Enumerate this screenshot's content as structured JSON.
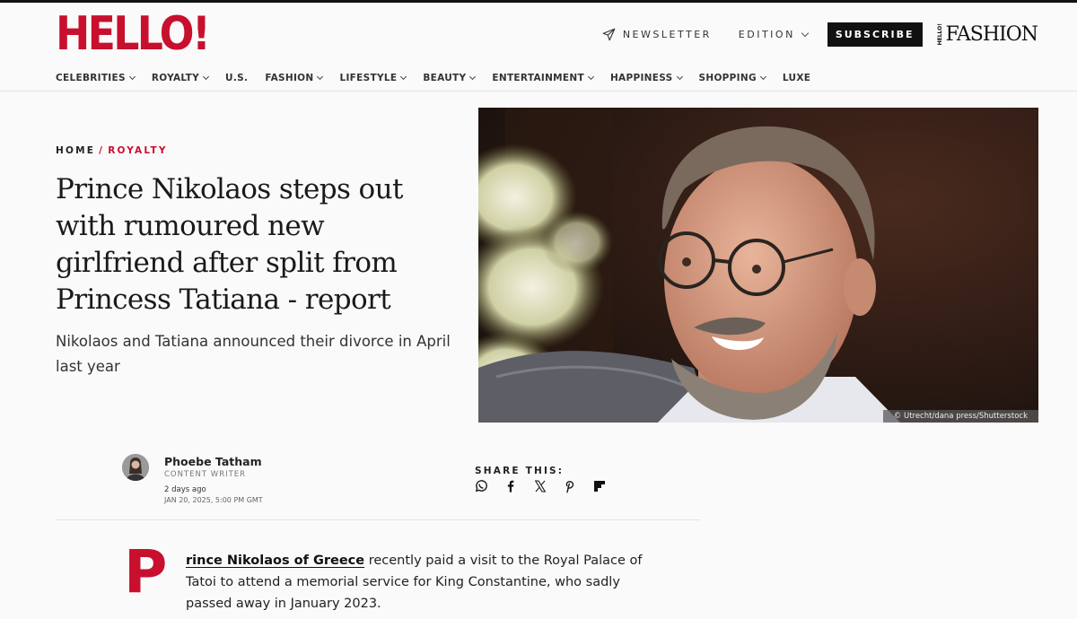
{
  "header": {
    "logo": "HELLO!",
    "newsletter_label": "NEWSLETTER",
    "edition_label": "EDITION",
    "subscribe_label": "SUBSCRIBE",
    "fashion_mini": "HELLO!",
    "fashion_word": "FASHION"
  },
  "nav": {
    "items": [
      {
        "label": "CELEBRITIES",
        "has_dropdown": true
      },
      {
        "label": "ROYALTY",
        "has_dropdown": true
      },
      {
        "label": "U.S.",
        "has_dropdown": false
      },
      {
        "label": "FASHION",
        "has_dropdown": true
      },
      {
        "label": "LIFESTYLE",
        "has_dropdown": true
      },
      {
        "label": "BEAUTY",
        "has_dropdown": true
      },
      {
        "label": "ENTERTAINMENT",
        "has_dropdown": true
      },
      {
        "label": "HAPPINESS",
        "has_dropdown": true
      },
      {
        "label": "SHOPPING",
        "has_dropdown": true
      },
      {
        "label": "LUXE",
        "has_dropdown": false
      }
    ]
  },
  "breadcrumb": {
    "home": "HOME",
    "separator": "/",
    "category": "ROYALTY"
  },
  "article": {
    "headline": "Prince Nikolaos steps out with rumoured new girlfriend after split from Princess Tatiana - report",
    "dek": "Nikolaos and Tatiana announced their divorce in April last year",
    "image_credit": "© Utrecht/dana press/Shutterstock",
    "author": {
      "name": "Phoebe Tatham",
      "role": "CONTENT WRITER",
      "date_relative": "2 days ago",
      "date_absolute": "JAN 20, 2025, 5:00 PM GMT"
    },
    "share_label": "SHARE THIS:",
    "share_icons": [
      "whatsapp-icon",
      "facebook-icon",
      "x-icon",
      "pinterest-icon",
      "flipboard-icon"
    ],
    "dropcap": "P",
    "body_link": "rince Nikolaos of Greece",
    "body_rest": " recently paid a visit to the Royal Palace of Tatoi to attend a memorial service for King Constantine, who sadly passed away in January 2023."
  },
  "colors": {
    "brand_red": "#c8102e",
    "text": "#222222",
    "background": "#fafafa"
  }
}
